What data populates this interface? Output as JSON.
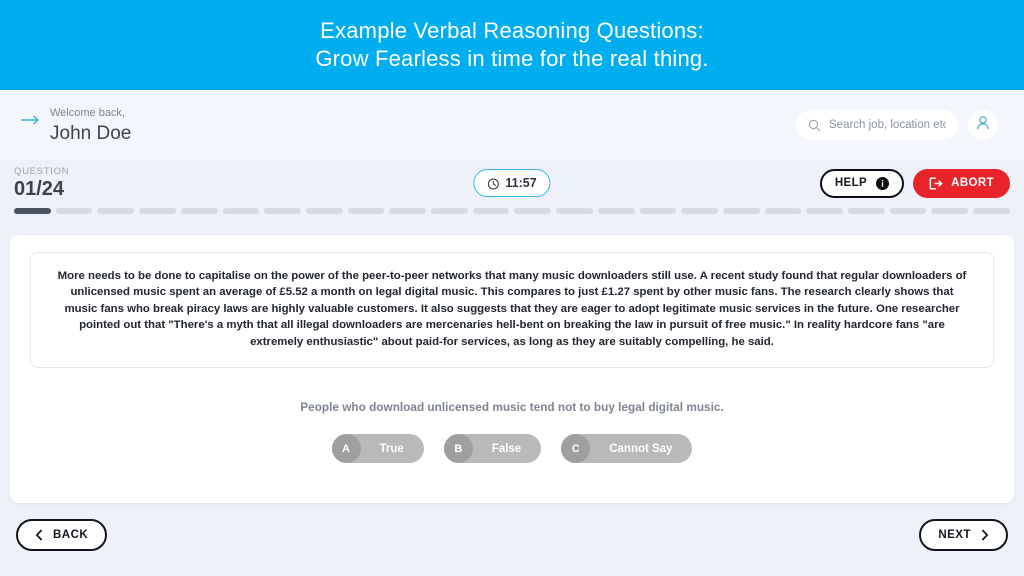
{
  "banner": {
    "line1": "Example Verbal Reasoning Questions:",
    "line2": "Grow Fearless in time for the real thing.",
    "bg_color": "#00aeef"
  },
  "userbar": {
    "welcome_label": "Welcome back,",
    "user_name": "John Doe",
    "arrow_icon": "arrow-right-icon",
    "search": {
      "icon": "search-icon",
      "placeholder": "Search job, location etc",
      "value": ""
    },
    "avatar_icon": "user-avatar-icon"
  },
  "question_header": {
    "count_label": "QUESTION",
    "count_value": "01/24",
    "timer": {
      "icon": "clock-icon",
      "value": "11:57",
      "border_color": "#36b6e8"
    },
    "help_button": {
      "label": "HELP",
      "icon": "info-icon"
    },
    "abort_button": {
      "label": "ABORT",
      "icon": "exit-icon",
      "bg_color": "#e8242a"
    }
  },
  "progress": {
    "total": 24,
    "completed": 1,
    "done_color": "#4a515f",
    "pending_color": "#d6dae2"
  },
  "passage": {
    "text": "More needs to be done to capitalise on the power of the peer-to-peer networks that many music downloaders still use. A recent study found that regular downloaders of unlicensed music spent an average of £5.52 a month on legal digital music. This compares to just £1.27 spent by other music fans. The research clearly shows that music fans who break piracy laws are highly valuable customers. It also suggests that they are eager to adopt legitimate music services in the future. One researcher pointed out that \"There's a myth that all illegal downloaders are mercenaries hell-bent on breaking the law in pursuit of free music.\" In reality hardcore fans \"are extremely enthusiastic\" about paid-for services, as long as they are suitably compelling, he said."
  },
  "question": {
    "stem": "People who download unlicensed music tend not to buy legal digital music.",
    "options": [
      {
        "letter": "A",
        "label": "True"
      },
      {
        "letter": "B",
        "label": "False"
      },
      {
        "letter": "C",
        "label": "Cannot Say"
      }
    ]
  },
  "footer": {
    "back_button": {
      "label": "BACK",
      "icon": "chevron-left-icon"
    },
    "next_button": {
      "label": "NEXT",
      "icon": "chevron-right-icon"
    }
  }
}
